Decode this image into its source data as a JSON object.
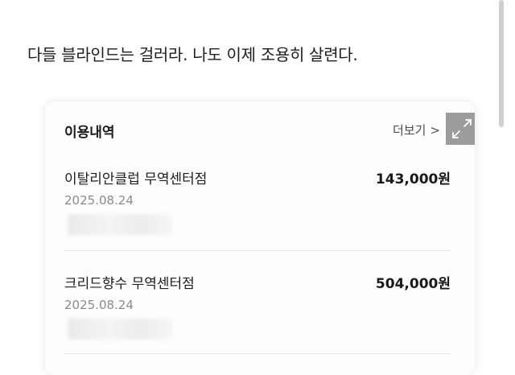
{
  "post": {
    "text": "다들 블라인드는 걸러라. 나도 이제 조용히 살련다."
  },
  "card": {
    "title": "이용내역",
    "more_label": "더보기",
    "more_chevron": ">",
    "expand_icon": "expand-arrows-icon",
    "transactions": [
      {
        "merchant": "이탈리안클럽 무역센터점",
        "amount": "143,000원",
        "date": "2025.08.24"
      },
      {
        "merchant": "크리드향수 무역센터점",
        "amount": "504,000원",
        "date": "2025.08.24"
      }
    ]
  },
  "colors": {
    "background": "#ffffff",
    "date_text": "#8a8a8a",
    "expand_button": "#9c9c9c"
  }
}
